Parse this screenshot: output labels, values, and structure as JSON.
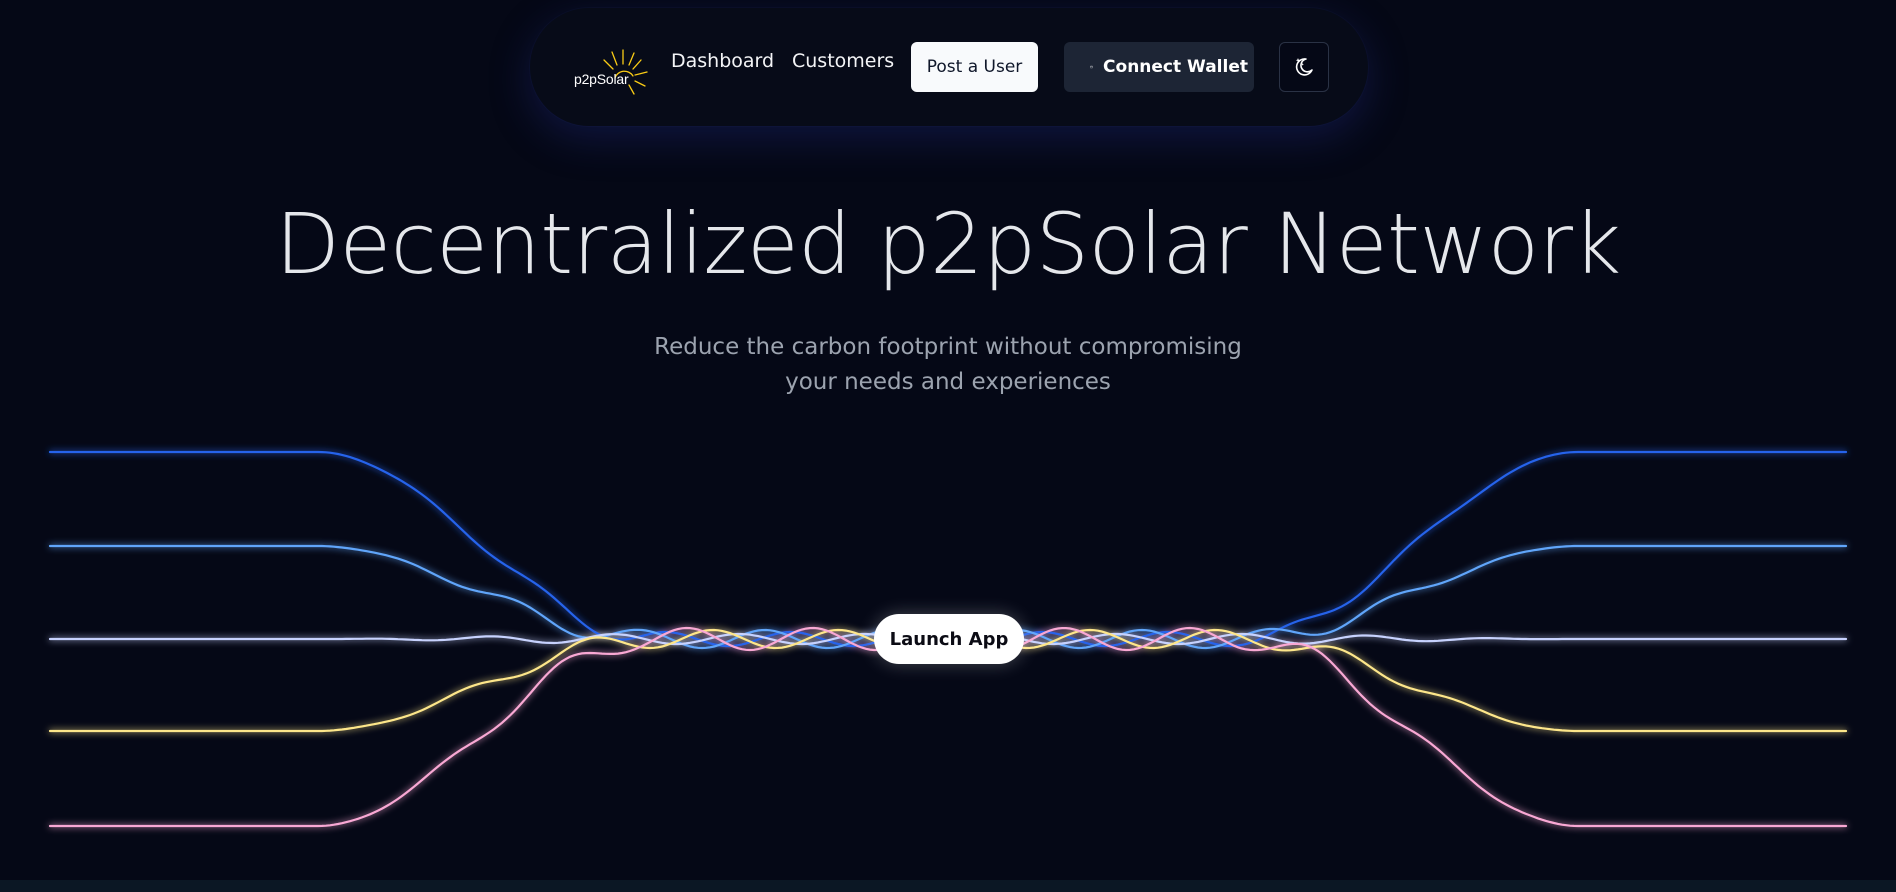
{
  "header": {
    "logo_text": "p2pSolar",
    "nav": {
      "dashboard": "Dashboard",
      "customers": "Customers"
    },
    "post_user_label": "Post a User",
    "connect_wallet_label": "Connect Wallet",
    "theme_toggle_icon": "moon-stars-icon"
  },
  "hero": {
    "title": "Decentralized p2pSolar Network",
    "subtitle": "Reduce the carbon footprint without compromising your needs and experiences",
    "launch_label": "Launch App"
  },
  "colors": {
    "background": "#050816",
    "logo_sun": "#facc15",
    "wave_blue_dark": "#2563eb",
    "wave_blue_light": "#60a5fa",
    "wave_lavender": "#c7d2fe",
    "wave_yellow": "#fde68a",
    "wave_pink": "#f9a8d4"
  }
}
